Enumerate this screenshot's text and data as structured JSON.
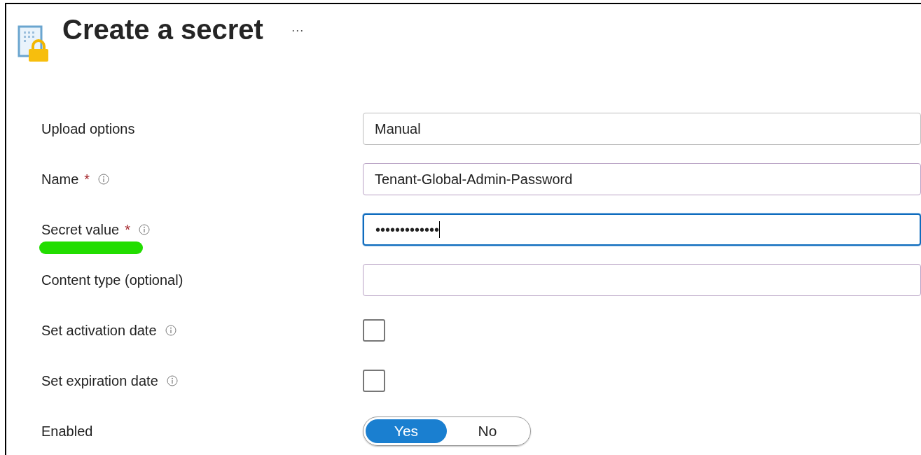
{
  "header": {
    "title": "Create a secret",
    "more": "···"
  },
  "fields": [
    {
      "kind": "select",
      "label": "Upload options",
      "info": false,
      "highlighted": false,
      "value": "Manual"
    },
    {
      "kind": "text",
      "label": "Name",
      "required": "*",
      "info": true,
      "highlighted": false,
      "focused": false,
      "value": "Tenant-Global-Admin-Password"
    },
    {
      "kind": "text",
      "label": "Secret value",
      "required": "*",
      "info": true,
      "highlighted": true,
      "focused": true,
      "value": "•••••••••••••"
    },
    {
      "kind": "text",
      "label": "Content type (optional)",
      "info": false,
      "highlighted": false,
      "focused": false
    },
    {
      "kind": "checkbox",
      "label": "Set activation date",
      "info": true,
      "highlighted": false,
      "checked": false
    },
    {
      "kind": "checkbox",
      "label": "Set expiration date",
      "info": true,
      "highlighted": false,
      "checked": false
    },
    {
      "kind": "toggle",
      "label": "Enabled",
      "info": false,
      "highlighted": false,
      "options": [
        {
          "label": "Yes",
          "selected": true
        },
        {
          "label": "No",
          "selected": false
        }
      ]
    }
  ]
}
